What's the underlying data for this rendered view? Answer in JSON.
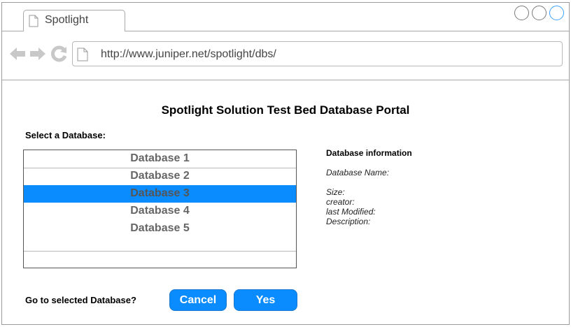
{
  "browser": {
    "tab_title": "Spotlight",
    "url": "http://www.juniper.net/spotlight/dbs/",
    "icons": [
      "back-arrow-icon",
      "forward-arrow-icon",
      "reload-icon",
      "page-icon"
    ]
  },
  "page": {
    "title": "Spotlight Solution Test Bed Database Portal",
    "select_label": "Select a Database:",
    "databases": [
      "Database 1",
      "Database 2",
      "Database 3",
      "Database 4",
      "Database 5"
    ],
    "selected_index": 2,
    "info": {
      "title": "Database information",
      "name_label": "Database Name:",
      "size_label": "Size:",
      "creator_label": "creator:",
      "modified_label": "last Modified:",
      "description_label": "Description:"
    },
    "confirm_label": "Go to selected Database?",
    "cancel_label": "Cancel",
    "yes_label": "Yes"
  },
  "colors": {
    "accent": "#0a8cff",
    "active_window_circle": "#3aa0ff"
  }
}
